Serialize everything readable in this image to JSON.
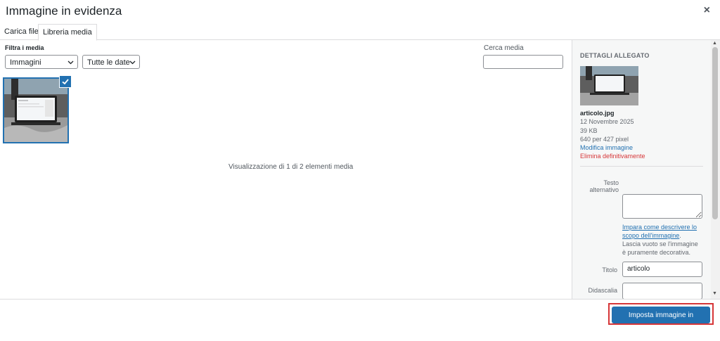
{
  "dialog": {
    "title": "Immagine in evidenza",
    "close_glyph": "×",
    "close_icon": "close-icon"
  },
  "tabs": [
    {
      "label": "Carica file",
      "active": false
    },
    {
      "label": "Libreria media",
      "active": true
    }
  ],
  "filters": {
    "label": "Filtra i media",
    "type_select": "Immagini",
    "date_select": "Tutte le date",
    "chevron_icon": "chevron-down-icon"
  },
  "search": {
    "label": "Cerca media",
    "value": ""
  },
  "media_grid": {
    "count_text": "Visualizzazione di 1 di 2 elementi media",
    "selected_icon": "checkmark-icon"
  },
  "details": {
    "heading": "DETTAGLI ALLEGATO",
    "filename": "articolo.jpg",
    "date": "12 Novembre 2025",
    "size": "39 KB",
    "dimensions": "640 per 427 pixel",
    "edit_link": "Modifica immagine",
    "delete_link": "Elimina definitivamente",
    "alt_label_line1": "Testo",
    "alt_label_line2": "alternativo",
    "alt_value": "",
    "help_link": "Impara come descrivere lo scopo dell'immagine",
    "help_rest": ". Lascia vuoto se l'immagine è puramente decorativa.",
    "title_label": "Titolo",
    "title_value": "articolo",
    "caption_label": "Didascalia",
    "caption_value": ""
  },
  "footer": {
    "primary_button": "Imposta immagine in evidenza"
  },
  "colors": {
    "accent": "#2271b1",
    "danger": "#d63638",
    "highlight_border": "#d63638"
  }
}
